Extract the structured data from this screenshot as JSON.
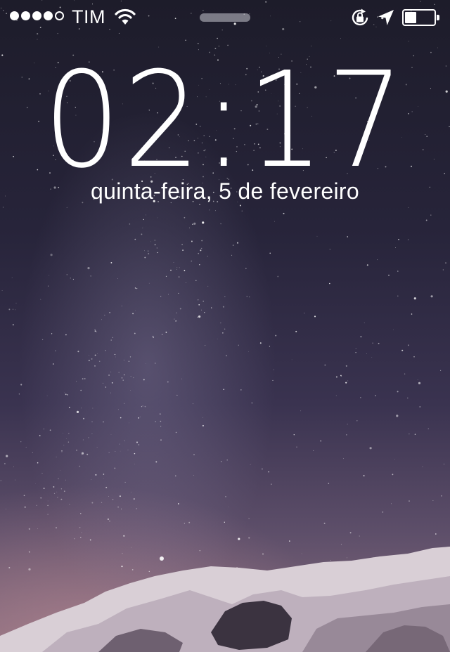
{
  "status_bar": {
    "signal_bars_total": 5,
    "signal_bars_filled": 4,
    "carrier": "TIM",
    "battery_level": 0.4
  },
  "lock_screen": {
    "time": "02:17",
    "date": "quinta-feira, 5 de fevereiro"
  },
  "colors": {
    "text": "#ffffff",
    "sky_top": "#1d1c2a",
    "sky_bottom": "#8a6e7e"
  },
  "icons": {
    "wifi": "wifi-icon",
    "rotation_lock": "rotation-lock-icon",
    "location": "location-arrow-icon",
    "battery": "battery-icon"
  }
}
